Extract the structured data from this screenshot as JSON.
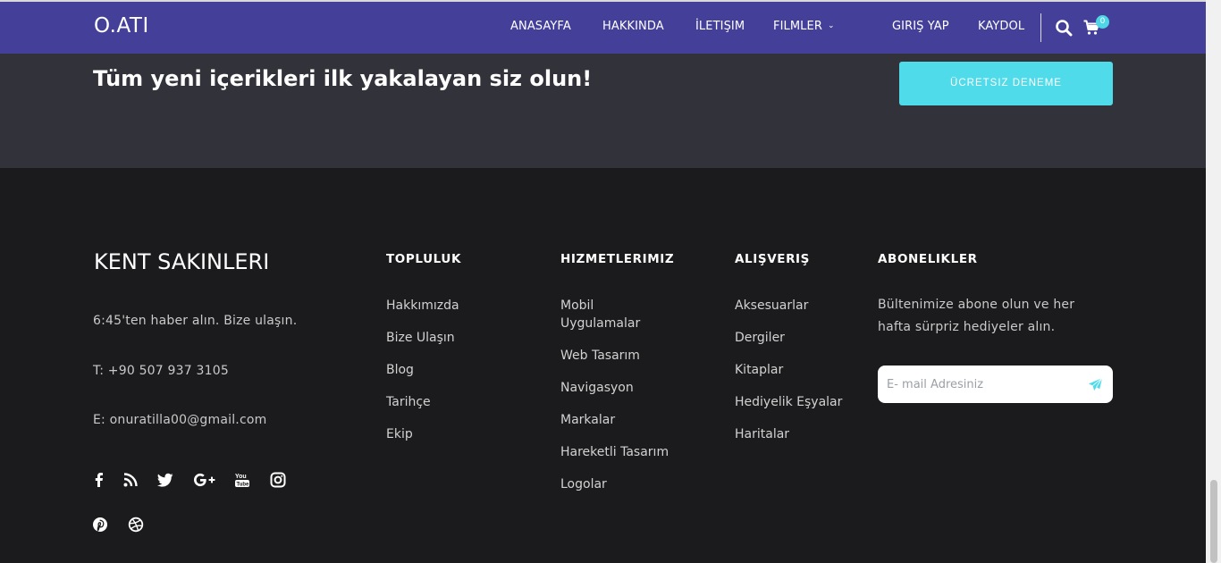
{
  "header": {
    "logo": "O.ATI",
    "nav": [
      "ANASAYFA",
      "HAKKINDA",
      "İLETIŞIM",
      "FILMLER",
      "GIRIŞ YAP",
      "KAYDOL"
    ],
    "cart_count": "0"
  },
  "cta": {
    "title": "Tüm yeni içerikleri ilk yakalayan siz olun!",
    "button": "ÜCRETSIZ DENEME"
  },
  "footer": {
    "brand": "KENT SAKINLERI",
    "contact": {
      "tagline": "6:45'ten haber alın. Bize ulaşın.",
      "phone": "T: +90 507 937 3105",
      "email": "E: onuratilla00@gmail.com"
    },
    "social_icons": [
      "facebook-icon",
      "rss-icon",
      "twitter-icon",
      "google-plus-icon",
      "youtube-icon",
      "instagram-icon",
      "pinterest-icon",
      "dribbble-icon"
    ],
    "columns": {
      "topluluk": {
        "title": "TOPLULUK",
        "links": [
          "Hakkımızda",
          "Bize Ulaşın",
          "Blog",
          "Tarihçe",
          "Ekip"
        ]
      },
      "hizmetler": {
        "title": "HIZMETLERIMIZ",
        "links": [
          "Mobil Uygulamalar",
          "Web Tasarım",
          "Navigasyon",
          "Markalar",
          "Hareketli Tasarım",
          "Logolar"
        ]
      },
      "alisveris": {
        "title": "ALIŞVERIŞ",
        "links": [
          "Aksesuarlar",
          "Dergiler",
          "Kitaplar",
          "Hediyelik Eşyalar",
          "Haritalar"
        ]
      },
      "abonelikler": {
        "title": "ABONELIKLER",
        "text": "Bültenimize abone olun ve her hafta sürpriz hediyeler alın.",
        "placeholder": "E- mail Adresiniz"
      }
    }
  },
  "colors": {
    "navbar": "#44409a",
    "cta_band": "#32323a",
    "accent": "#4fdbe9",
    "footer": "#1b1b1d"
  }
}
